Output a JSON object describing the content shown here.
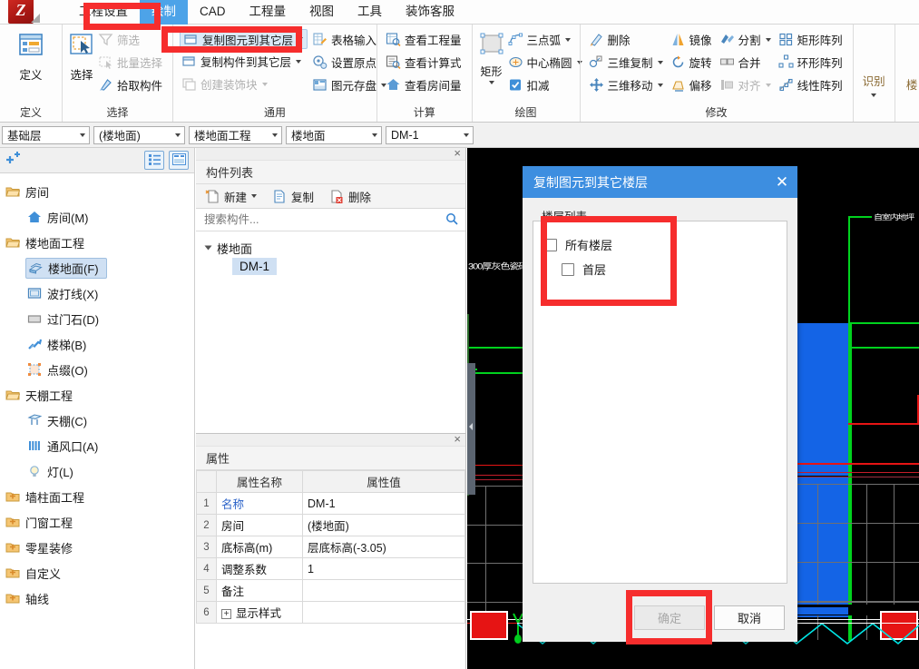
{
  "app": {
    "logo_letter": "Z"
  },
  "tabs": [
    {
      "label": "工程设置",
      "active": false
    },
    {
      "label": "绘制",
      "active": true
    },
    {
      "label": "CAD",
      "active": false
    },
    {
      "label": "工程量",
      "active": false
    },
    {
      "label": "视图",
      "active": false
    },
    {
      "label": "工具",
      "active": false
    },
    {
      "label": "装饰客服",
      "active": false
    }
  ],
  "ribbon": {
    "groups": [
      {
        "title": "定义",
        "big": [
          {
            "label": "定义",
            "icon": "define-icon"
          }
        ]
      },
      {
        "title": "选择",
        "big": [
          {
            "label": "选择",
            "icon": "select-icon"
          }
        ],
        "items": [
          {
            "label": "筛选",
            "icon": "filter-icon",
            "disabled": true
          },
          {
            "label": "批量选择",
            "icon": "batch-select-icon",
            "disabled": true
          },
          {
            "label": "拾取构件",
            "icon": "pick-component-icon",
            "disabled": false
          }
        ]
      },
      {
        "title": "通用",
        "col_a": [
          {
            "label": "复制图元到其它层",
            "icon": "copy-element-icon",
            "caret": true,
            "highlight": true
          },
          {
            "label": "复制构件到其它层",
            "icon": "copy-component-icon",
            "caret": true
          },
          {
            "label": "创建装饰块",
            "icon": "create-block-icon",
            "caret": true,
            "disabled": true
          }
        ],
        "col_b": [
          {
            "label": "表格输入",
            "icon": "table-input-icon"
          },
          {
            "label": "设置原点",
            "icon": "set-origin-icon"
          },
          {
            "label": "图元存盘",
            "icon": "save-element-icon",
            "caret": true
          }
        ]
      },
      {
        "title": "计算",
        "items": [
          {
            "label": "查看工程量",
            "icon": "view-quantity-icon"
          },
          {
            "label": "查看计算式",
            "icon": "view-formula-icon"
          },
          {
            "label": "查看房间量",
            "icon": "view-room-quantity-icon"
          }
        ]
      },
      {
        "title": "绘图",
        "big": [
          {
            "label": "矩形",
            "icon": "rectangle-icon",
            "caret": true
          }
        ],
        "items": [
          {
            "label": "三点弧",
            "icon": "three-point-arc-icon",
            "caret": true
          },
          {
            "label": "中心椭圆",
            "icon": "center-ellipse-icon",
            "caret": true
          },
          {
            "label": "扣减",
            "icon": "deduct-checkbox-icon",
            "checked": true
          }
        ]
      },
      {
        "title": "修改",
        "col_a": [
          {
            "label": "删除",
            "icon": "delete-icon"
          },
          {
            "label": "三维复制",
            "icon": "copy-3d-icon",
            "caret": true
          },
          {
            "label": "三维移动",
            "icon": "move-3d-icon",
            "caret": true
          }
        ],
        "col_b": [
          {
            "label": "镜像",
            "icon": "mirror-icon"
          },
          {
            "label": "旋转",
            "icon": "rotate-icon"
          },
          {
            "label": "偏移",
            "icon": "offset-icon"
          }
        ],
        "col_c": [
          {
            "label": "分割",
            "icon": "split-icon",
            "caret": true
          },
          {
            "label": "合并",
            "icon": "merge-icon"
          },
          {
            "label": "对齐",
            "icon": "align-icon",
            "caret": true,
            "disabled": true
          }
        ],
        "col_d": [
          {
            "label": "矩形阵列",
            "icon": "rect-array-icon"
          },
          {
            "label": "环形阵列",
            "icon": "polar-array-icon"
          },
          {
            "label": "线性阵列",
            "icon": "linear-array-icon"
          }
        ]
      },
      {
        "title": "",
        "big": [
          {
            "label": "识别",
            "icon": "recognize-icon",
            "caret": true
          }
        ]
      },
      {
        "title": "",
        "big": [
          {
            "label": "楼",
            "icon": "floor-icon"
          }
        ]
      }
    ]
  },
  "selector_bar": [
    {
      "name": "floor-select",
      "value": "基础层"
    },
    {
      "name": "room-select",
      "value": "(楼地面)"
    },
    {
      "name": "discipline-select",
      "value": "楼地面工程"
    },
    {
      "name": "component-type-select",
      "value": "楼地面"
    },
    {
      "name": "component-select",
      "value": "DM-1"
    }
  ],
  "tree_panel": {
    "toolbar": {
      "add_icon": "add-plus-icon",
      "list_view_icon": "list-view-icon",
      "detail_view_icon": "detail-view-icon"
    },
    "nodes": [
      {
        "label": "房间",
        "icon": "folder-open-icon",
        "level": 0,
        "selected": false
      },
      {
        "label": "房间(M)",
        "icon": "room-icon",
        "level": 1,
        "selected": false
      },
      {
        "label": "楼地面工程",
        "icon": "folder-open-icon",
        "level": 0,
        "selected": false
      },
      {
        "label": "楼地面(F)",
        "icon": "floor-surface-icon",
        "level": 1,
        "selected": true
      },
      {
        "label": "波打线(X)",
        "icon": "border-line-icon",
        "level": 1,
        "selected": false
      },
      {
        "label": "过门石(D)",
        "icon": "door-stone-icon",
        "level": 1,
        "selected": false
      },
      {
        "label": "楼梯(B)",
        "icon": "stair-icon",
        "level": 1,
        "selected": false
      },
      {
        "label": "点缀(O)",
        "icon": "decoration-icon",
        "level": 1,
        "selected": false
      },
      {
        "label": "天棚工程",
        "icon": "folder-open-icon",
        "level": 0,
        "selected": false
      },
      {
        "label": "天棚(C)",
        "icon": "ceiling-icon",
        "level": 1,
        "selected": false
      },
      {
        "label": "通风口(A)",
        "icon": "vent-icon",
        "level": 1,
        "selected": false
      },
      {
        "label": "灯(L)",
        "icon": "lamp-icon",
        "level": 1,
        "selected": false
      },
      {
        "label": "墙柱面工程",
        "icon": "folder-closed-icon",
        "level": 0,
        "selected": false
      },
      {
        "label": "门窗工程",
        "icon": "folder-closed-icon",
        "level": 0,
        "selected": false
      },
      {
        "label": "零星装修",
        "icon": "folder-closed-icon",
        "level": 0,
        "selected": false
      },
      {
        "label": "自定义",
        "icon": "folder-closed-icon",
        "level": 0,
        "selected": false
      },
      {
        "label": "轴线",
        "icon": "folder-closed-icon",
        "level": 0,
        "selected": false
      }
    ]
  },
  "component_list": {
    "title": "构件列表",
    "close_icon": "close-icon",
    "toolbar": [
      {
        "label": "新建",
        "icon": "new-icon",
        "caret": true
      },
      {
        "label": "复制",
        "icon": "copy-icon",
        "caret": false
      },
      {
        "label": "删除",
        "icon": "delete-doc-icon",
        "caret": false
      }
    ],
    "search_placeholder": "搜索构件...",
    "search_value": "",
    "search_icon": "search-icon",
    "group_label": "楼地面",
    "selected_item": "DM-1"
  },
  "properties": {
    "title": "属性",
    "close_icon": "close-icon",
    "columns": [
      "",
      "属性名称",
      "属性值"
    ],
    "rows": [
      {
        "n": "1",
        "name": "名称",
        "value": "DM-1"
      },
      {
        "n": "2",
        "name": "房间",
        "value": "(楼地面)"
      },
      {
        "n": "3",
        "name": "底标高(m)",
        "value": "层底标高(-3.05)"
      },
      {
        "n": "4",
        "name": "调整系数",
        "value": "1"
      },
      {
        "n": "5",
        "name": "备注",
        "value": ""
      },
      {
        "n": "6",
        "name": "显示样式",
        "value": "",
        "expandable": true
      }
    ]
  },
  "canvas": {
    "annotation_left": "300厚灰色瓷砖",
    "annotation_right": "自室内地坪",
    "colors": {
      "background": "#000000",
      "green": "#00d21e",
      "blue": "#1464e6",
      "red": "#e61414",
      "cyan": "#00e6e6",
      "gray": "#707070",
      "white": "#ffffff"
    }
  },
  "dialog": {
    "title": "复制图元到其它楼层",
    "close_icon": "close-icon",
    "group_label": "楼层列表",
    "checkboxes": [
      {
        "label": "所有楼层",
        "checked": false,
        "indent": false
      },
      {
        "label": "首层",
        "checked": false,
        "indent": true
      }
    ],
    "ok_label": "确定",
    "ok_disabled": true,
    "cancel_label": "取消"
  },
  "annotations": {
    "highlight_color": "#f62d2d",
    "boxes": [
      {
        "name": "tab-highlight-box"
      },
      {
        "name": "ribbon-copy-element-box"
      },
      {
        "name": "dialog-checkbox-box"
      },
      {
        "name": "dialog-ok-box"
      }
    ]
  }
}
